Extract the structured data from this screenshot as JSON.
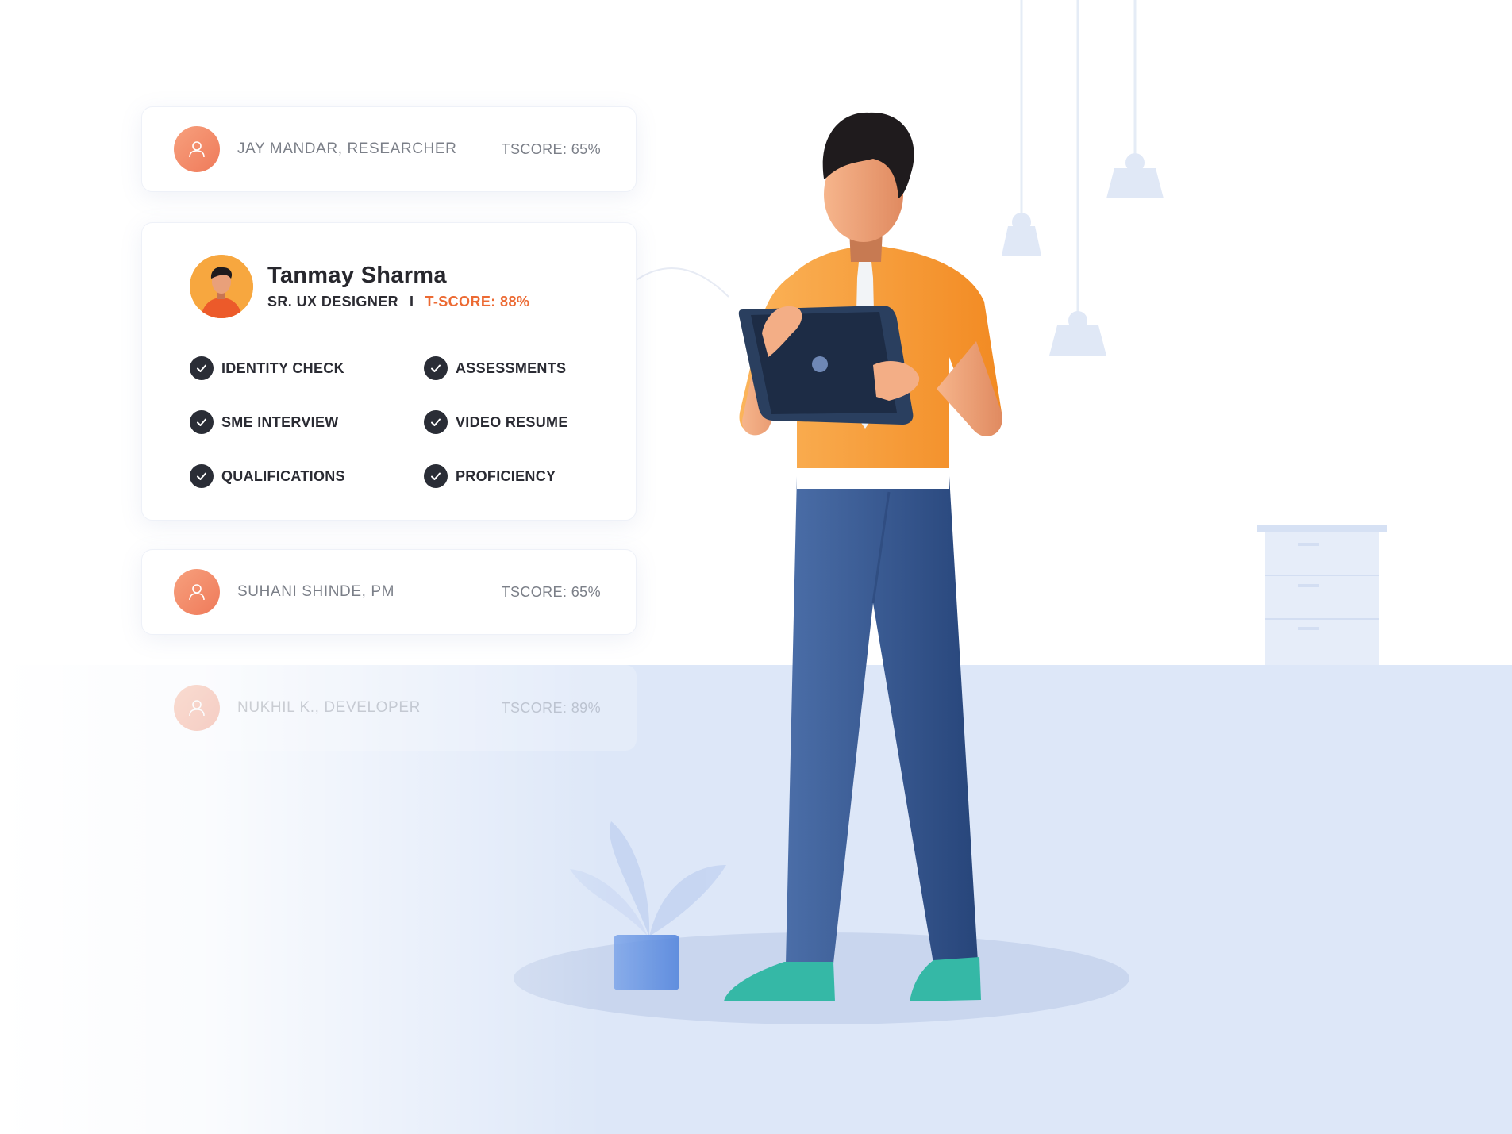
{
  "candidates": [
    {
      "name": "JAY MANDAR, RESEARCHER",
      "score": "TSCORE: 65%"
    },
    {
      "name": "SUHANI SHINDE, PM",
      "score": "TSCORE: 65%"
    },
    {
      "name": "NUKHIL K., DEVELOPER",
      "score": "TSCORE: 89%"
    }
  ],
  "profile": {
    "name": "Tanmay Sharma",
    "role": "SR. UX DESIGNER",
    "separator": "I",
    "tscore": "T-SCORE: 88%",
    "checks": [
      "IDENTITY CHECK",
      "ASSESSMENTS",
      "SME INTERVIEW",
      "VIDEO RESUME",
      "QUALIFICATIONS",
      "PROFICIENCY"
    ]
  },
  "icons": {
    "candidate_avatar": "user-icon",
    "check": "check-circle-icon"
  },
  "colors": {
    "accent": "#ec6a33",
    "avatar": "#f28b6a",
    "floor": "#dde7f8",
    "shirt": "#f7982f",
    "pants": "#2f4f86"
  }
}
